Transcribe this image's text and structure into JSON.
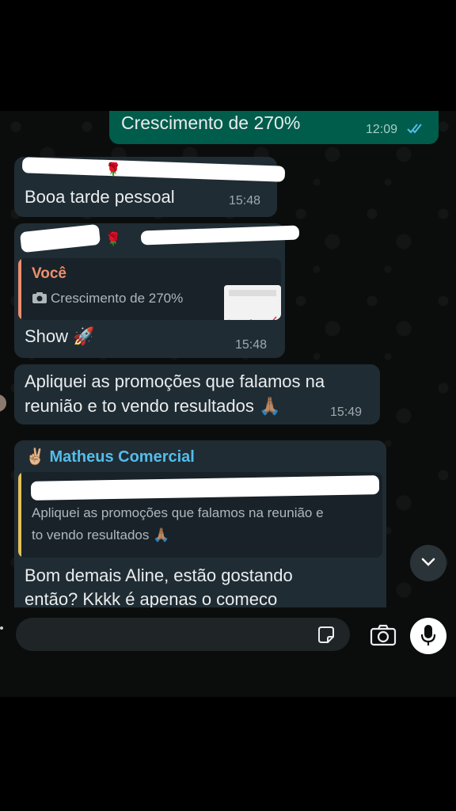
{
  "messages": [
    {
      "id": "m1",
      "direction": "out",
      "text": "Crescimento de 270%",
      "time": "12:09",
      "status": "read"
    },
    {
      "id": "m2",
      "direction": "in",
      "text": "Booa tarde pessoal",
      "time": "15:48"
    },
    {
      "id": "m3",
      "direction": "in",
      "quote_author": "Você",
      "quote_text": "Crescimento de 270%",
      "text": "Show 🚀",
      "time": "15:48"
    },
    {
      "id": "m4",
      "direction": "in",
      "text_line1": "Apliquei as promoções que falamos na",
      "text_line2": "reunião e to vendo resultados 🙏🏽",
      "time": "15:49"
    },
    {
      "id": "m5",
      "direction": "in",
      "sender": "✌🏼 Matheus Comercial",
      "quote_line1": "Apliquei as promoções que falamos na reunião e",
      "quote_line2": "to vendo resultados 🙏🏽",
      "text_line1": "Bom demais Aline, estão gostando",
      "text_line2": "então? Kkkk é apenas o comeco"
    }
  ],
  "composer": {
    "placeholder": ""
  },
  "colors": {
    "outgoing": "#005c4b",
    "incoming": "#202c33",
    "read_ticks": "#53bdeb",
    "quote_you": "#ee8f6e",
    "quote_other": "#e5c158",
    "sender": "#53bdeb"
  },
  "icons": [
    "read-ticks-icon",
    "camera-icon",
    "rocket-icon",
    "scroll-down-icon",
    "sticker-icon",
    "mic-icon"
  ]
}
